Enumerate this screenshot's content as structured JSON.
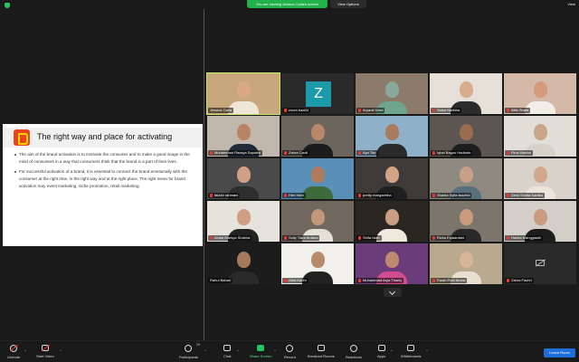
{
  "banner": {
    "sharing_text": "You are viewing Jessica Carla's screen",
    "view_options": "View Options",
    "view": "View"
  },
  "slide": {
    "title": "The right way and place for activating",
    "bullets": [
      "The aim of the brand activation is to motivate the consumer and to make a good image in the mind of consumers in a way that consumers think that the brand is a part of their lives.",
      "For successful activation of a brand, it is essential to connect the brand emotionally with the consumer at the right time, in the right way and at the right place. The right mean for brand activation may event marketing, niche promotion, retail marketing."
    ]
  },
  "participants": [
    {
      "name": "Jessica Carla",
      "muted": false,
      "active": true,
      "bg": "#c9a77c",
      "skin": "#d9a884",
      "shirt": "#f0e6d8"
    },
    {
      "name": "zoom baa04",
      "muted": true,
      "avatar": "Z",
      "bg": "#2a2a2a"
    },
    {
      "name": "Aryanti Dewi",
      "muted": true,
      "bg": "#8c7a6a",
      "skin": "#8aa89a",
      "shirt": "#6fa58f"
    },
    {
      "name": "Salsa Nadhira",
      "muted": true,
      "bg": "#e6e0d8",
      "skin": "#d8ad8e",
      "shirt": "#2b2b2b"
    },
    {
      "name": "Alifa Shafa",
      "muted": true,
      "bg": "#d4b8a8",
      "skin": "#d59a7c",
      "shirt": "#f2ede6"
    },
    {
      "name": "Muhammad Rassya Saputra",
      "muted": true,
      "bg": "#c2b7ad",
      "skin": "#b98465",
      "shirt": "#222b3a"
    },
    {
      "name": "Zahra Caufi",
      "muted": true,
      "bg": "#6b655e",
      "skin": "#b88868",
      "shirt": "#1c1c1c"
    },
    {
      "name": "Ayu Tiur",
      "muted": true,
      "bg": "#8fb0c9",
      "skin": "#a87a5e",
      "shirt": "#2a2a2a"
    },
    {
      "name": "Iqbal Bagus Hadiarto",
      "muted": true,
      "bg": "#5c5650",
      "skin": "#9a6c50",
      "shirt": "#1e1e1e"
    },
    {
      "name": "Firra Marvini",
      "muted": true,
      "bg": "#e2ded8",
      "skin": "#c9a689",
      "shirt": "#d7d2c9"
    },
    {
      "name": "faizah rahmani",
      "muted": true,
      "bg": "#4a4a4a",
      "skin": "#cfa085",
      "shirt": "#2e2e2e"
    },
    {
      "name": "Heri Herv",
      "muted": true,
      "bg": "#5a8fb8",
      "skin": "#b07b5c",
      "shirt": "#3d6b3a"
    },
    {
      "name": "pretty margaretha",
      "muted": true,
      "bg": "#3e3a37",
      "skin": "#d3a385",
      "shirt": "#1f1f1f"
    },
    {
      "name": "Shania Syifa fauzhid",
      "muted": true,
      "bg": "#8e8a80",
      "skin": "#c8a089",
      "shirt": "#5a6f7c"
    },
    {
      "name": "Dewi Shinta Kartika",
      "muted": true,
      "bg": "#d8d2ca",
      "skin": "#d1a88d",
      "shirt": "#ece4db"
    },
    {
      "name": "Andai Marsya Shabira",
      "muted": true,
      "bg": "#e6e2dc",
      "skin": "#cf9f84",
      "shirt": "#222222"
    },
    {
      "name": "Sully Tiara Ardana",
      "muted": true,
      "bg": "#70685e",
      "skin": "#c29679",
      "shirt": "#e5e0d7"
    },
    {
      "name": "Shifa Islah",
      "muted": true,
      "bg": "#2a2622",
      "skin": "#c7a083",
      "shirt": "#efe8dc"
    },
    {
      "name": "Rizka Eqiaardani",
      "muted": true,
      "bg": "#7c756b",
      "skin": "#c99a7c",
      "shirt": "#292929"
    },
    {
      "name": "Hanita Manggiasih",
      "muted": true,
      "bg": "#d3cfc8",
      "skin": "#c99b80",
      "shirt": "#1d1d1d"
    },
    {
      "name": "Rahul Bahari",
      "muted": false,
      "bg": "#1c1c1c",
      "skin": "#a4795c",
      "shirt": "#2a2a2a"
    },
    {
      "name": "Atha Karim",
      "muted": true,
      "bg": "#f2f0ec",
      "skin": "#b88a6c",
      "shirt": "#222222"
    },
    {
      "name": "Muhammad Arya Thoriq",
      "muted": true,
      "bg": "#6a3d7a",
      "skin": "#bb8a6c",
      "shirt": "#d24d8f"
    },
    {
      "name": "Farah Putri Itrona",
      "muted": true,
      "bg": "#b9a98f",
      "skin": "#d8b596",
      "shirt": "#e9dfd0"
    },
    {
      "name": "Zahra Fachri",
      "muted": true,
      "camera_off": true,
      "bg": "#2a2a2a"
    }
  ],
  "toolbar": {
    "unmute": "Unmute",
    "start_video": "Start Video",
    "participants": "Participants",
    "participants_count": "29",
    "chat": "Chat",
    "share_screen": "Share Screen",
    "record": "Record",
    "breakout_rooms": "Breakout Rooms",
    "reactions": "Reactions",
    "apps": "Apps",
    "whiteboards": "Whiteboards",
    "leave": "Leave Room"
  },
  "colors": {
    "banner_green": "#21b24b",
    "leave_blue": "#1e6fd9",
    "active_speaker": "#c5e86c",
    "muted_red": "#e53935"
  }
}
